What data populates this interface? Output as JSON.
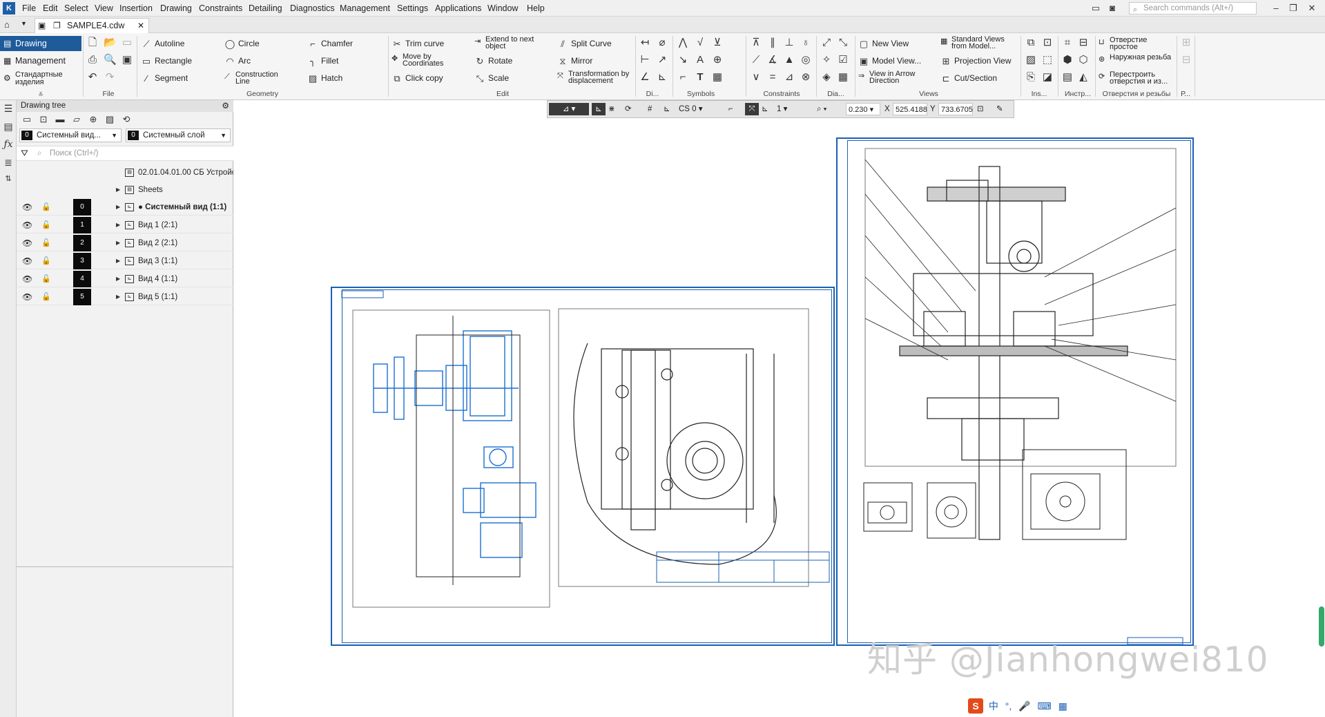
{
  "menubar": {
    "items": [
      "File",
      "Edit",
      "Select",
      "View",
      "Insertion",
      "Drawing",
      "Constraints",
      "Detailing",
      "Diagnostics",
      "Management",
      "Settings",
      "Applications",
      "Window",
      "Help"
    ],
    "search_placeholder": "Search commands (Alt+/)"
  },
  "tabbar": {
    "document_tab": "SAMPLE4.cdw"
  },
  "left_tabs": [
    "Drawing",
    "Management",
    "Стандартные изделия"
  ],
  "ribbon": {
    "file": {
      "group_label": "File"
    },
    "geometry": {
      "group_label": "Geometry",
      "items": [
        "Autoline",
        "Circle",
        "Chamfer",
        "Rectangle",
        "Arc",
        "Fillet",
        "Segment",
        "Construction Line",
        "Hatch"
      ]
    },
    "edit": {
      "group_label": "Edit",
      "items": [
        "Trim curve",
        "Extend to next object",
        "Split Curve",
        "Move by Coordinates",
        "Rotate",
        "Mirror",
        "Click copy",
        "Scale",
        "Transformation by displacement"
      ]
    },
    "small_groups": [
      "Di...",
      "Symbols",
      "Constraints",
      "Dia..."
    ],
    "views": {
      "group_label": "Views",
      "items": [
        "New View",
        "Standard Views from Model...",
        "Model View...",
        "Projection View",
        "View in Arrow Direction",
        "Cut/Section"
      ]
    },
    "ins_label": "Ins...",
    "instr_label": "Инстр...",
    "holes": {
      "group_label": "Отверстия и резьбы",
      "items": [
        "Отверстие простое",
        "Наружная резьба",
        "Перестроить отверстия и из..."
      ]
    },
    "last_label": "Р..."
  },
  "tree": {
    "title": "Drawing tree",
    "view_combo": {
      "num": "0",
      "label": "Системный вид..."
    },
    "layer_combo": {
      "num": "0",
      "label": "Системный слой"
    },
    "search_placeholder": "Поиск (Ctrl+/)",
    "document_name": "02.01.04.01.00 СБ Устройс",
    "sheets_label": "Sheets",
    "views": [
      {
        "num": "0",
        "label": "Системный вид (1:1)"
      },
      {
        "num": "1",
        "label": "Вид 1 (2:1)"
      },
      {
        "num": "2",
        "label": "Вид 2 (2:1)"
      },
      {
        "num": "3",
        "label": "Вид 3 (1:1)"
      },
      {
        "num": "4",
        "label": "Вид 4 (1:1)"
      },
      {
        "num": "5",
        "label": "Вид 5 (1:1)"
      }
    ]
  },
  "floatbar": {
    "cs": "CS 0",
    "step": "1",
    "zoom": "0.230",
    "x_label": "X",
    "x_value": "525.4188",
    "y_label": "Y",
    "y_value": "733.6705"
  },
  "watermark": "知乎 @Jianhongwei810",
  "ime": {
    "logo": "S",
    "lang": "中"
  }
}
